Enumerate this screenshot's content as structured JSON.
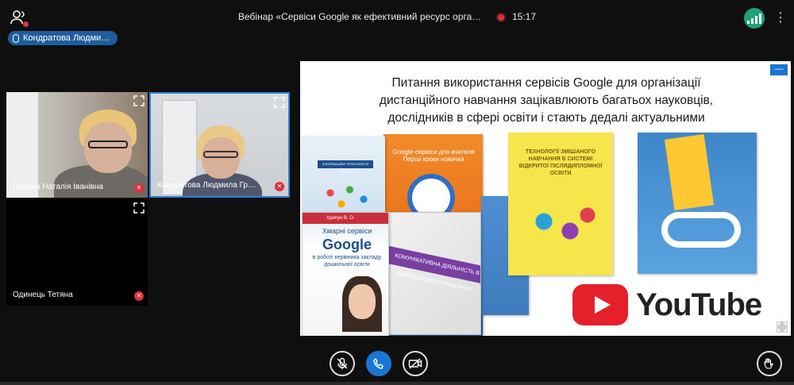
{
  "header": {
    "title": "Вебінар «Сервіси Google як ефективний ресурс організації дис…",
    "timer": "15:17",
    "colors": {
      "record": "#e0303b",
      "signal": "#1fa37a",
      "accent": "#1976d2"
    }
  },
  "speaker_chip": {
    "label": "Кондратова Людми…"
  },
  "tiles": [
    {
      "name": "Гущина Наталія Іванівна",
      "muted": true,
      "active": false
    },
    {
      "name": "Кондратова Людмила Гр…",
      "muted": true,
      "active": true
    },
    {
      "name": "Одинець Тетяна",
      "muted": true,
      "active": false
    }
  ],
  "slide": {
    "heading_lines": [
      "Питання використання сервісів  Google для організації",
      "дистанційного навчання зацікавлюють багатьох науковців,",
      "дослідників в сфері освіти і стають дедалі актуальними"
    ],
    "minimize_label": "—",
    "books": {
      "b1_band": "ІНФОРМАЦІЙНІ ТЕХНОЛОГІЇ В ОСВІТІ",
      "b2_title": "Google-сервіси для вчителя Перші кроки новачка",
      "b3_author": "Хрипун В. О.",
      "b3_subtitle": "Хмарні сервіси",
      "b3_logo": "Google",
      "b3_desc": "в роботі керівника закладу дошкільної освіти",
      "b4_band": "КОМУНІКАТИВНА ДІЯЛЬНІСТЬ В ДЕРЖАВНОМУ УПРАВЛІННІ",
      "b6_title": "ТЕХНОЛОГІЇ ЗМІШАНОГО НАВЧАННЯ В СИСТЕМІ ВІДКРИТОЇ ПІСЛЯДИПЛОМНОЇ ОСВІТИ"
    },
    "youtube_word": "YouTube"
  },
  "controls": {
    "mic_icon": "mic-off-icon",
    "call_icon": "phone-icon",
    "camera_icon": "camera-off-icon",
    "hand_icon": "raise-hand-icon"
  }
}
